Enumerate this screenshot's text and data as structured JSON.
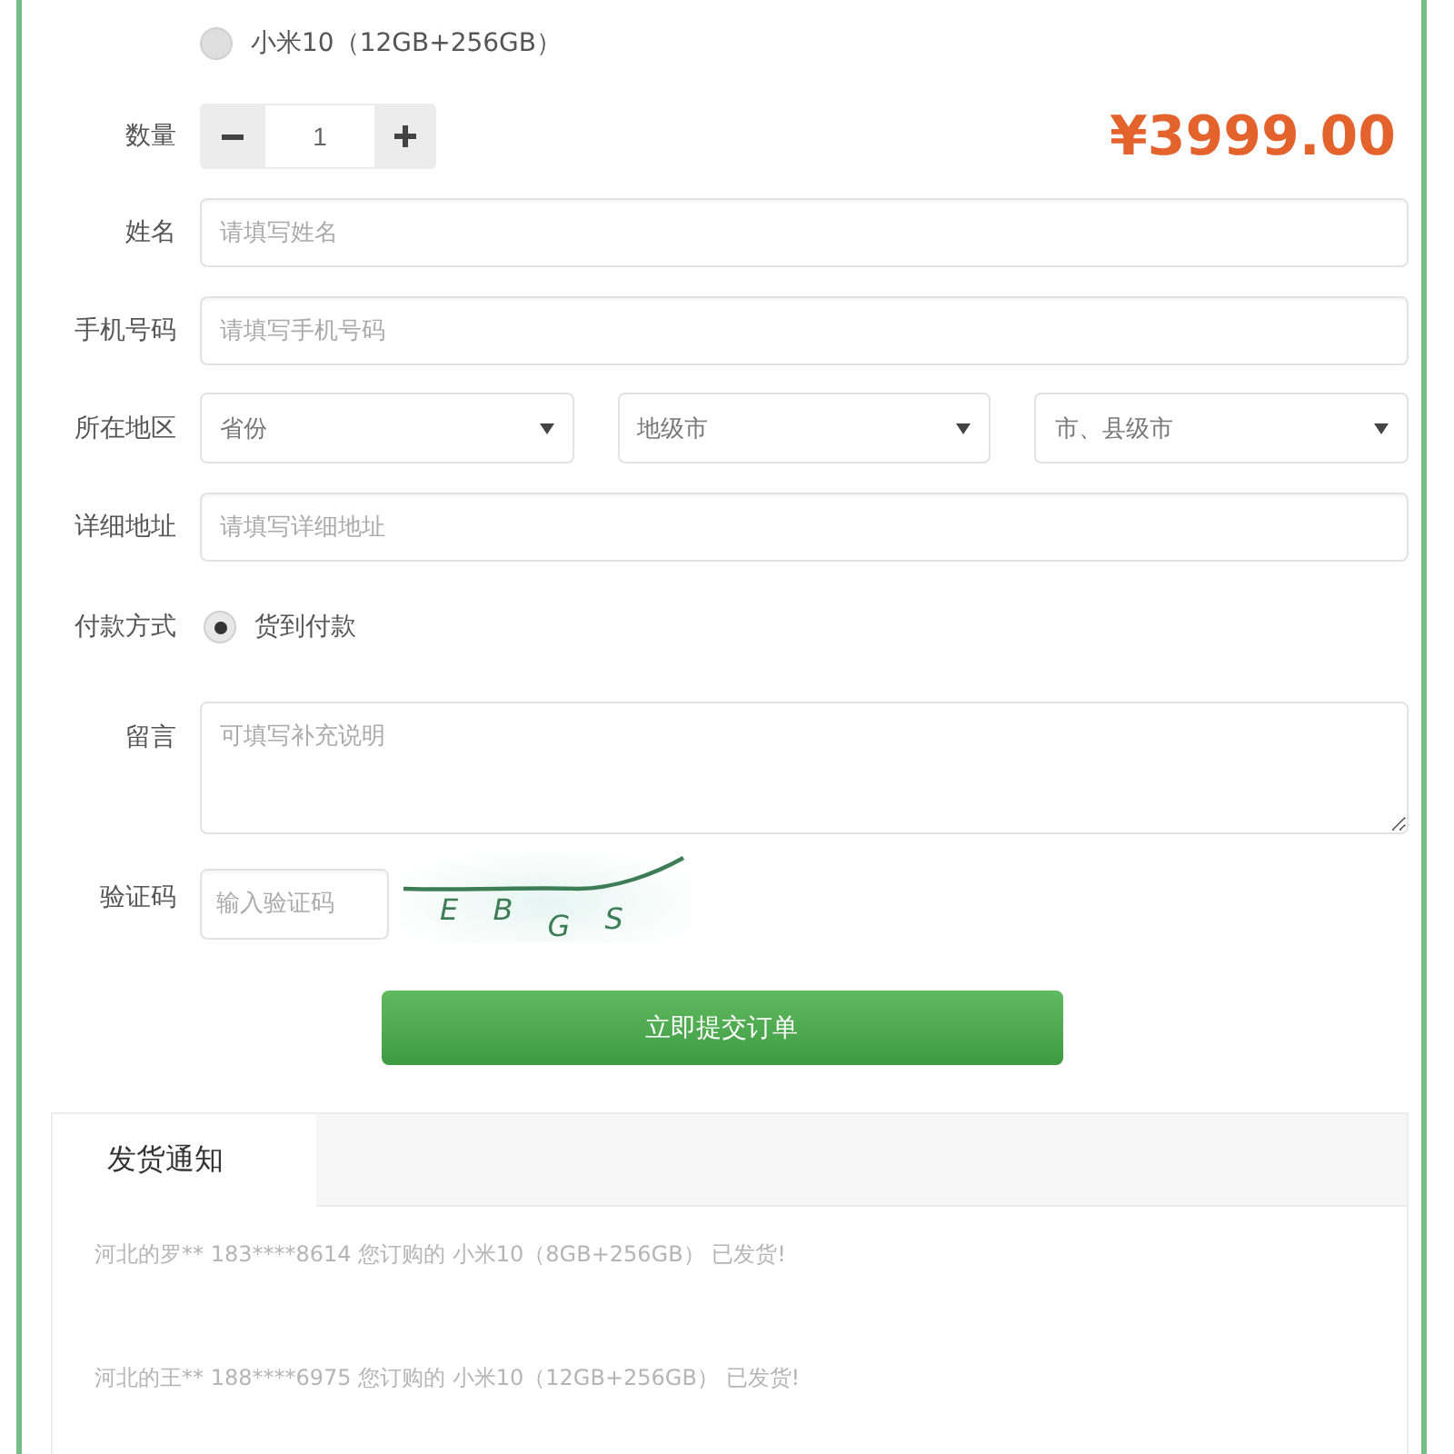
{
  "product_options": [
    {
      "label": "小米10（12GB+256GB）",
      "selected": false
    }
  ],
  "quantity": {
    "label": "数量",
    "value": "1"
  },
  "price": "¥3999.00",
  "fields": [
    {
      "kind": "text",
      "label": "姓名",
      "placeholder": "请填写姓名"
    },
    {
      "kind": "text",
      "label": "手机号码",
      "placeholder": "请填写手机号码"
    },
    {
      "kind": "region",
      "label": "所在地区",
      "values": [
        "省份",
        "地级市",
        "市、县级市"
      ]
    },
    {
      "kind": "text",
      "label": "详细地址",
      "placeholder": "请填写详细地址"
    },
    {
      "kind": "radio",
      "label": "付款方式",
      "choices": [
        {
          "label": "货到付款",
          "selected": true
        }
      ]
    },
    {
      "kind": "textarea",
      "label": "留言",
      "placeholder": "可填写补充说明"
    },
    {
      "kind": "captcha",
      "label": "验证码",
      "placeholder": "输入验证码",
      "code": "E B G S"
    }
  ],
  "submit": "立即提交订单",
  "notice_panel": {
    "tabs": [
      {
        "label": "发货通知",
        "selected": true
      }
    ],
    "items": [
      "河北的罗** 183****8614 您订购的 小米10（8GB+256GB） 已发货!",
      "河北的王** 188****6975 您订购的 小米10（12GB+256GB） 已发货!"
    ]
  }
}
